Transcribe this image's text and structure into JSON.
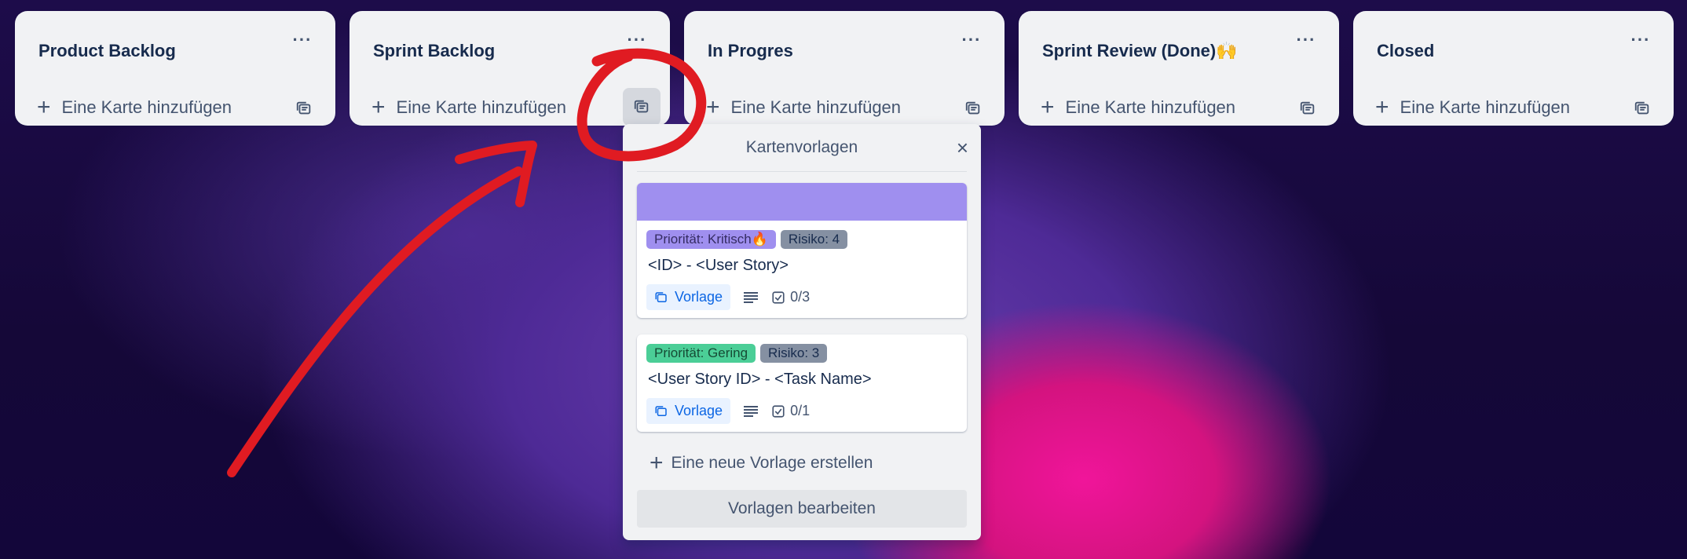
{
  "lists": [
    {
      "title": "Product Backlog",
      "add_label": "Eine Karte hinzufügen"
    },
    {
      "title": "Sprint Backlog",
      "add_label": "Eine Karte hinzufügen"
    },
    {
      "title": "In Progres",
      "add_label": "Eine Karte hinzufügen"
    },
    {
      "title": "Sprint Review (Done)🙌",
      "add_label": "Eine Karte hinzufügen"
    },
    {
      "title": "Closed",
      "add_label": "Eine Karte hinzufügen"
    }
  ],
  "menu_glyph": "···",
  "popover": {
    "title": "Kartenvorlagen",
    "close": "×",
    "cards": [
      {
        "cover_color": "#9f8fef",
        "labels": [
          {
            "text": "Priorität: Kritisch🔥",
            "bg": "#9f8fef",
            "fg": "#352c63"
          },
          {
            "text": "Risiko: 4",
            "bg": "#8590a2",
            "fg": "#172b4d"
          }
        ],
        "title": "<ID> - <User Story>",
        "template_badge": "Vorlage",
        "checklist": "0/3"
      },
      {
        "labels": [
          {
            "text": "Priorität: Gering",
            "bg": "#4bce97",
            "fg": "#164b35"
          },
          {
            "text": "Risiko: 3",
            "bg": "#8590a2",
            "fg": "#172b4d"
          }
        ],
        "title": "<User Story ID> - <Task Name>",
        "template_badge": "Vorlage",
        "checklist": "0/1"
      }
    ],
    "new_template": "Eine neue Vorlage erstellen",
    "edit_templates": "Vorlagen bearbeiten"
  },
  "colors": {
    "annotation": "#e01b22"
  }
}
